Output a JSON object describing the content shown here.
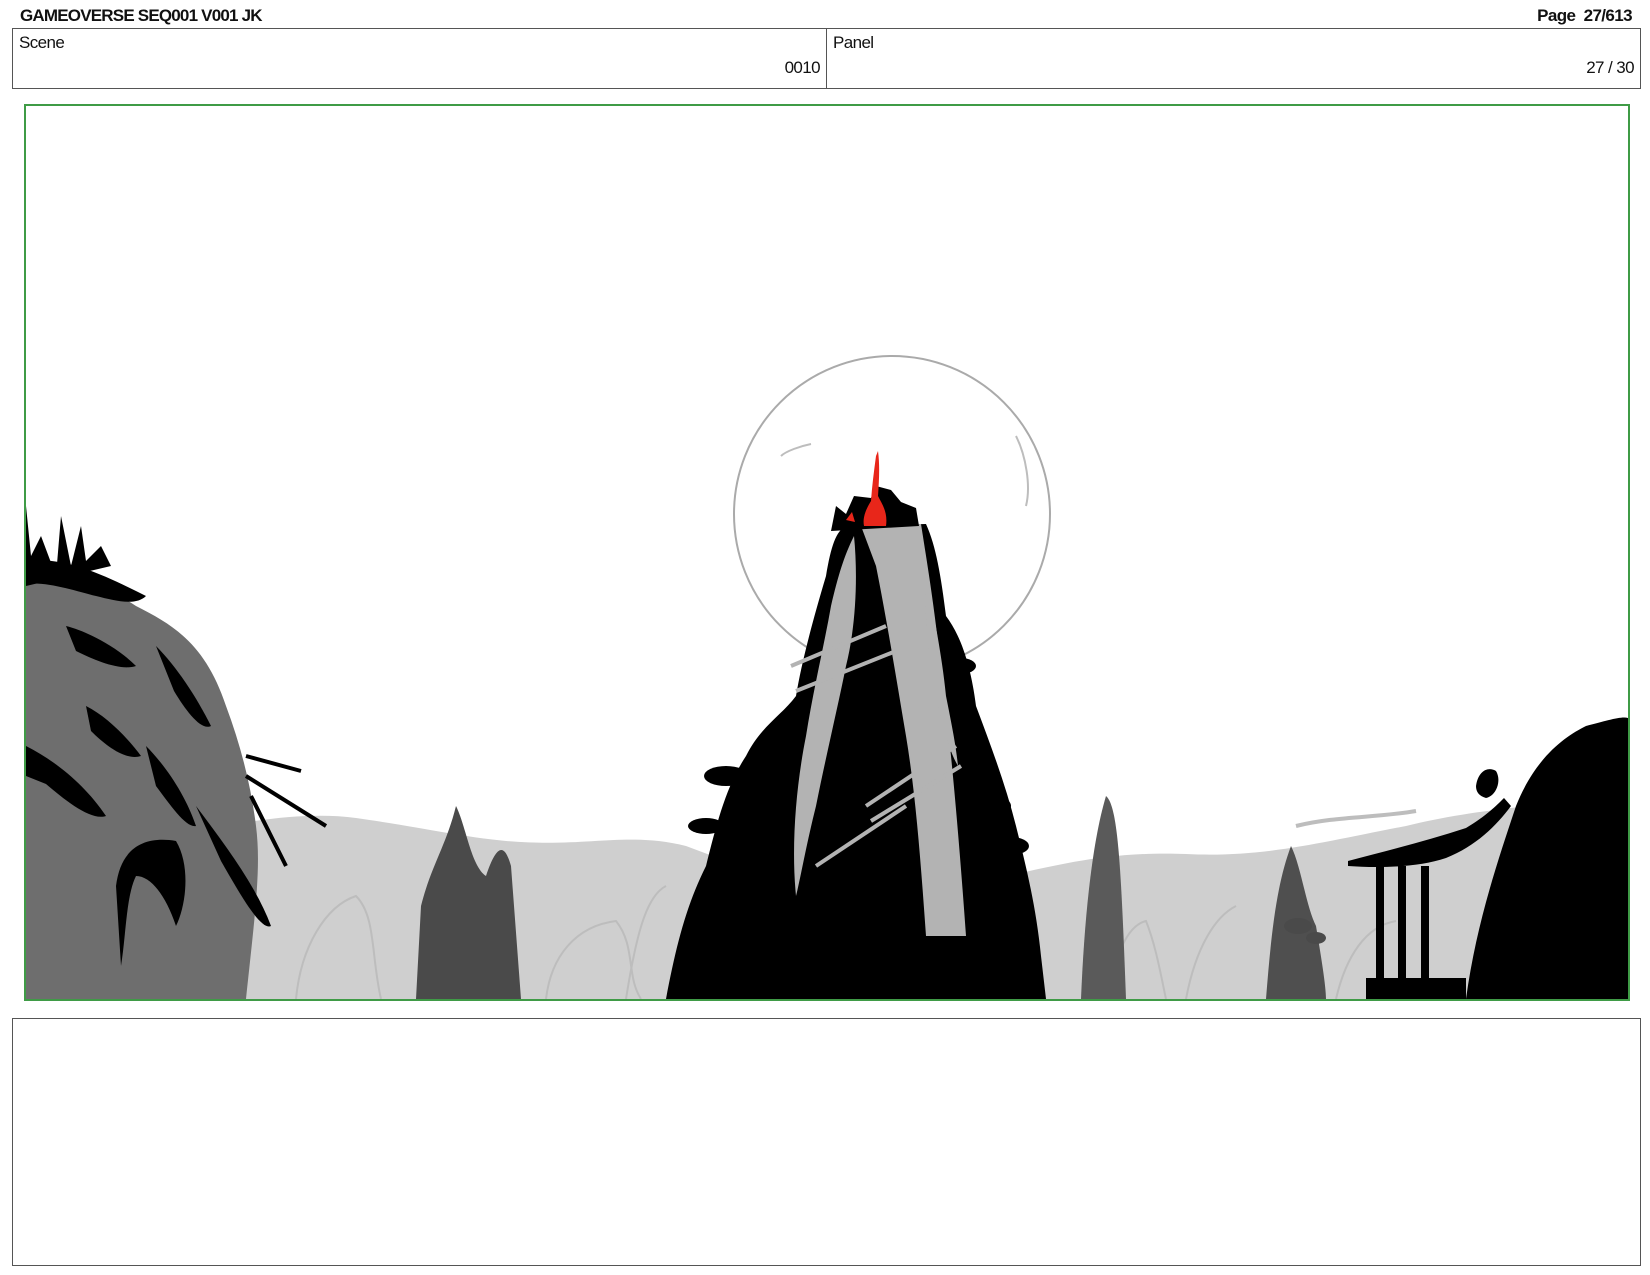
{
  "header": {
    "title": "GAMEOVERSE SEQ001 V001 JK",
    "page_label": "Page",
    "page_number": "27/613"
  },
  "info": {
    "scene_label": "Scene",
    "scene_value": "0010",
    "panel_label": "Panel",
    "panel_value": "27 / 30"
  },
  "colors": {
    "frame_border": "#3f9b46",
    "accent_red": "#e8261a"
  }
}
